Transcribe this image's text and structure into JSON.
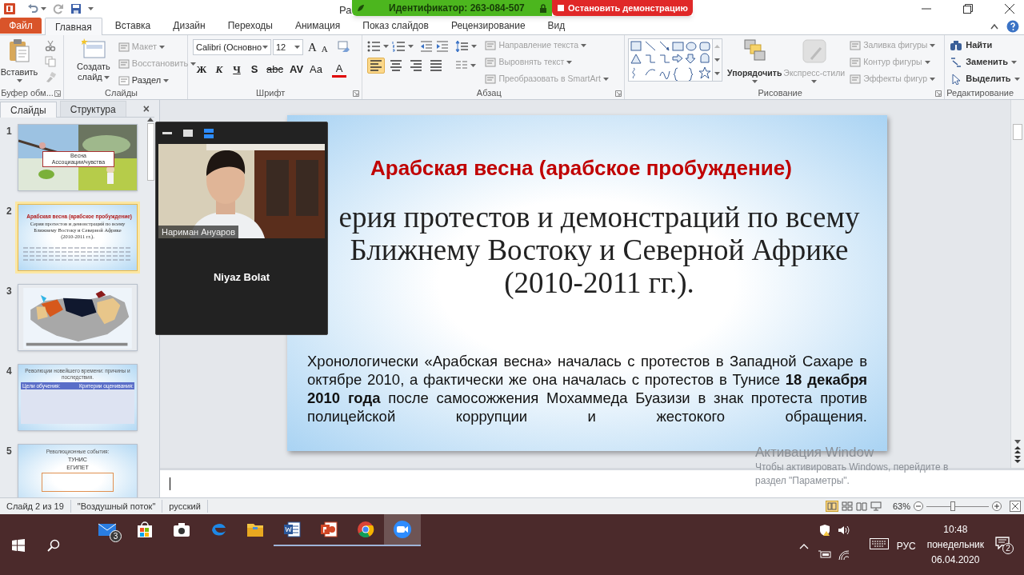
{
  "title_bar": {
    "title": "Ра"
  },
  "share_bar": {
    "meeting_id": "Идентификатор: 263-084-507",
    "stop_button": "Остановить демонстрацию"
  },
  "tabs": [
    {
      "label": "Файл",
      "kind": "file",
      "selected": false
    },
    {
      "label": "Главная",
      "kind": "tab",
      "selected": true
    },
    {
      "label": "Вставка",
      "kind": "tab",
      "selected": false
    },
    {
      "label": "Дизайн",
      "kind": "tab",
      "selected": false
    },
    {
      "label": "Переходы",
      "kind": "tab",
      "selected": false
    },
    {
      "label": "Анимация",
      "kind": "tab",
      "selected": false
    },
    {
      "label": "Показ слайдов",
      "kind": "tab",
      "selected": false
    },
    {
      "label": "Рецензирование",
      "kind": "tab",
      "selected": false
    },
    {
      "label": "Вид",
      "kind": "tab",
      "selected": false
    }
  ],
  "ribbon": {
    "clipboard": {
      "label": "Буфер обм...",
      "paste": "Вставить"
    },
    "slides": {
      "label": "Слайды",
      "new_slide": [
        "Создать",
        "слайд"
      ],
      "items": [
        {
          "label": "Макет",
          "disabled": true
        },
        {
          "label": "Восстановить",
          "disabled": true
        },
        {
          "label": "Раздел",
          "disabled": false
        }
      ]
    },
    "font": {
      "label": "Шрифт",
      "font_name": "Calibri (Основно",
      "font_size": "12",
      "size_buttons": [
        "A",
        "A"
      ],
      "format_buttons": [
        "Ж",
        "К",
        "Ч",
        "S",
        "abc",
        "AV",
        "Aa",
        "A"
      ]
    },
    "paragraph": {
      "label": "Абзац",
      "items": [
        {
          "label": "Направление текста",
          "disabled": true
        },
        {
          "label": "Выровнять текст",
          "disabled": true
        },
        {
          "label": "Преобразовать в SmartArt",
          "disabled": true
        }
      ],
      "align_buttons": [
        {
          "kind": "left",
          "selected": true
        },
        {
          "kind": "center",
          "selected": false
        },
        {
          "kind": "right",
          "selected": false
        },
        {
          "kind": "justify",
          "selected": false
        }
      ]
    },
    "drawing": {
      "label": "Рисование",
      "arrange": "Упорядочить",
      "quick_styles": "Экспресс-стили",
      "items": [
        {
          "label": "Заливка фигуры",
          "disabled": true
        },
        {
          "label": "Контур фигуры",
          "disabled": true
        },
        {
          "label": "Эффекты фигур",
          "disabled": true
        }
      ]
    },
    "editing": {
      "label": "Редактирование",
      "items": [
        {
          "label": "Найти",
          "kind": "find"
        },
        {
          "label": "Заменить",
          "kind": "replace"
        },
        {
          "label": "Выделить",
          "kind": "select"
        }
      ]
    }
  },
  "slide_panel": {
    "tabs": [
      {
        "label": "Слайды",
        "selected": true
      },
      {
        "label": "Структура",
        "selected": false
      }
    ],
    "close": "×",
    "thumbnails": [
      {
        "number": "1",
        "kind": "photos",
        "selected": false,
        "caption": [
          "Весна",
          "Ассоциации/чувства"
        ]
      },
      {
        "number": "2",
        "kind": "text",
        "selected": true,
        "title": "Арабская весна (арабское пробуждение)",
        "lines": [
          "Серия протестов и демонстраций по всему",
          "Ближнему Востоку и Северной Африке",
          "(2010-2011 гг.)."
        ]
      },
      {
        "number": "3",
        "kind": "map",
        "selected": false
      },
      {
        "number": "4",
        "kind": "table",
        "selected": false,
        "title": "Революции новейшего времени: причины и последствия.",
        "columns": [
          "Цели обучения:",
          "Критерии оценивания:"
        ]
      },
      {
        "number": "5",
        "kind": "list",
        "selected": false,
        "title": "Революционные события:",
        "lines": [
          "ТУНИС",
          "ЕГИПЕТ"
        ]
      }
    ]
  },
  "slide": {
    "title": "Арабская весна (арабское пробуждение)",
    "subtitle": "ерия протестов и демонстраций по всему Ближнему Востоку и Северной Африке (2010-2011 гг.).",
    "body": "Хронологически «Арабская весна» началась с протестов в Западной Сахаре в октябре 2010, а фактически же она началась с протестов в Тунисе **18 декабря 2010 года** после самосожжения Мохаммеда Буазизи в знак протеста против полицейской коррупции и жестокого обращения."
  },
  "video_panel": {
    "speaker": "Нариман Ануаров",
    "participant": "Niyaz Bolat"
  },
  "activation_notice": {
    "title": "Активация Window",
    "lines": [
      "Чтобы активировать Windows, перейдите в",
      "раздел \"Параметры\"."
    ]
  },
  "status_bar": {
    "slide": "Слайд 2 из 19",
    "theme": "\"Воздушный поток\"",
    "language": "русский",
    "zoom": "63%",
    "zoom_slider": {
      "level": 0.42
    }
  },
  "taskbar": {
    "apps": [
      {
        "kind": "mail",
        "badge": "3",
        "open": false,
        "active": false
      },
      {
        "kind": "store",
        "open": false,
        "active": false
      },
      {
        "kind": "camera",
        "open": false,
        "active": false
      },
      {
        "kind": "edge",
        "open": false,
        "active": false
      },
      {
        "kind": "explorer",
        "open": false,
        "active": false
      },
      {
        "kind": "word",
        "open": true,
        "active": false
      },
      {
        "kind": "powerpoint",
        "open": true,
        "active": false
      },
      {
        "kind": "chrome",
        "open": true,
        "active": false
      },
      {
        "kind": "zoom",
        "open": true,
        "active": true
      }
    ],
    "language": "РУС",
    "time": "10:48",
    "day": "понедельник",
    "date": "06.04.2020",
    "notifications": "2"
  }
}
